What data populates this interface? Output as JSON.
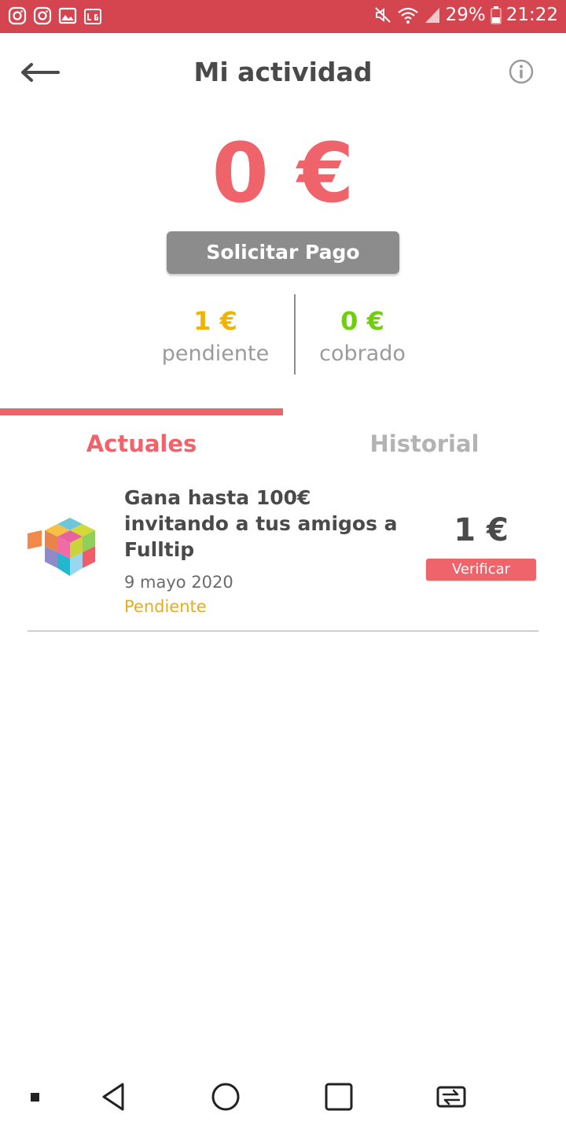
{
  "status_bar": {
    "battery": "29%",
    "time": "21:22"
  },
  "header": {
    "title": "Mi actividad"
  },
  "balance": {
    "amount": "0 €",
    "request_payment_label": "Solicitar Pago"
  },
  "stats": {
    "pending_amount": "1 €",
    "pending_label": "pendiente",
    "paid_amount": "0 €",
    "paid_label": "cobrado"
  },
  "tabs": [
    {
      "label": "Actuales",
      "active": true
    },
    {
      "label": "Historial",
      "active": false
    }
  ],
  "items": [
    {
      "title": "Gana hasta 100€ invitando a tus amigos a Fulltip",
      "date": "9 mayo 2020",
      "status": "Pendiente",
      "amount": "1 €",
      "action_label": "Verificar"
    }
  ],
  "colors": {
    "status_bar": "#d4454f",
    "accent": "#ef636b",
    "pending": "#f0b400",
    "paid": "#6fcf0a",
    "button_gray": "#8c8c8c",
    "status_pending": "#e8ad14"
  }
}
